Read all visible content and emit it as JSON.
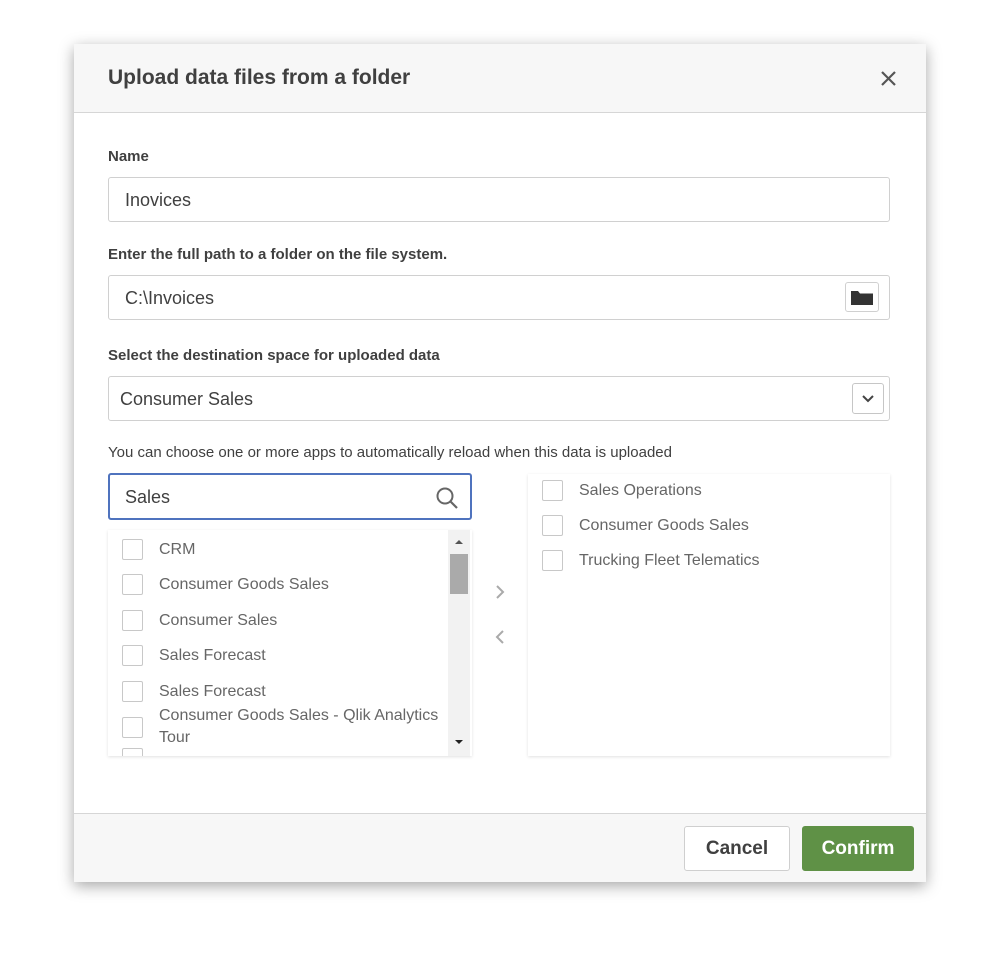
{
  "dialog": {
    "title": "Upload data files from a folder"
  },
  "name_field": {
    "label": "Name",
    "value": "Inovices"
  },
  "path_field": {
    "label": "Enter the full path to a folder on the file system.",
    "value": "C:\\Invoices"
  },
  "space_field": {
    "label": "Select the destination space for uploaded data",
    "selected": "Consumer Sales"
  },
  "apps": {
    "hint": "You can choose one or more apps to automatically reload when this data is uploaded",
    "search_value": "Sales",
    "available": [
      "CRM",
      "Consumer Goods Sales",
      "Consumer Sales",
      "Sales Forecast",
      "Sales Forecast",
      "Consumer Goods Sales - Qlik Analytics Tour"
    ],
    "selected": [
      "Sales Operations",
      "Consumer Goods Sales",
      "Trucking Fleet Telematics"
    ]
  },
  "footer": {
    "cancel_label": "Cancel",
    "confirm_label": "Confirm"
  },
  "colors": {
    "accent": "#4f73be",
    "confirm": "#5f9146"
  },
  "icons": {
    "close": "close-icon",
    "folder": "folder-icon",
    "dropdown": "chevron-down-icon",
    "search": "search-icon",
    "move_right": "chevron-right-icon",
    "move_left": "chevron-left-icon"
  }
}
